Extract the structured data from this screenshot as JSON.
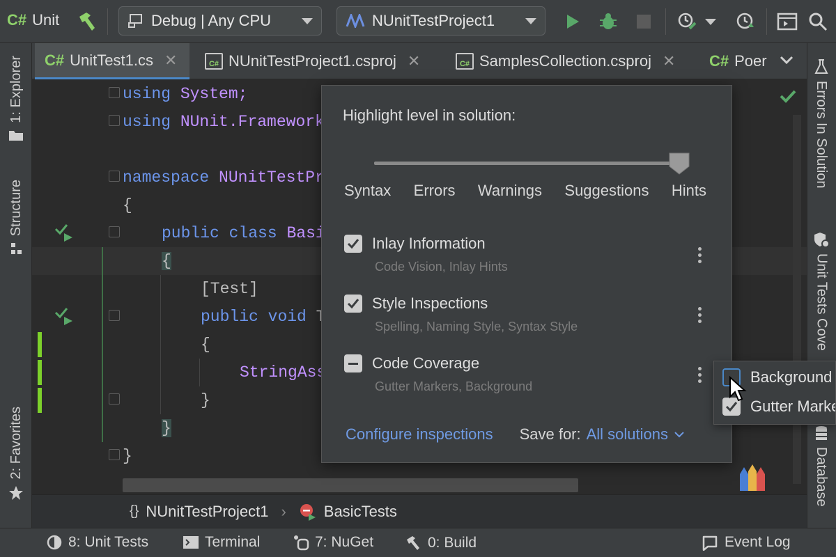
{
  "toolbar": {
    "lang_tag": "C#",
    "project": "Unit",
    "config": "Debug | Any CPU",
    "run_config": "NUnitTestProject1",
    "icons": [
      "hammer-icon",
      "run-icon",
      "debug-icon",
      "stop-icon",
      "profile-icon",
      "coverage-icon",
      "layout-icon",
      "search-icon"
    ]
  },
  "tabs": [
    {
      "tag": "C#",
      "label": "UnitTest1.cs",
      "active": true
    },
    {
      "tag": "C#",
      "label": "NUnitTestProject1.csproj"
    },
    {
      "tag": "C#",
      "label": "SamplesCollection.csproj"
    },
    {
      "tag": "C#",
      "label": "Poer"
    }
  ],
  "left_tools": {
    "explorer": "1: Explorer",
    "structure": "Structure",
    "favorites": "2: Favorites"
  },
  "right_tools": {
    "errors": "Errors In Solution",
    "unit_tests_coverage": "Unit Tests Cove",
    "database": "Database"
  },
  "code": {
    "line1_kw": "using",
    "line1_ns": "System;",
    "line2_kw": "using",
    "line2_ns": "NUnit.Framework",
    "line3_kw": "namespace",
    "line3_ns": "NUnitTestPr",
    "line4": "{",
    "line5_kw1": "public",
    "line5_kw2": "class",
    "line5_ns": "Basi",
    "line6": "{",
    "line7": "[Test]",
    "line8_kw1": "public",
    "line8_kw2": "void",
    "line8_rest": "T",
    "line9": "{",
    "line10": "StringAss",
    "line11": "}",
    "line12": "}",
    "line13": "}"
  },
  "breadcrumb": {
    "namespace": "NUnitTestProject1",
    "class": "BasicTests"
  },
  "bottom": {
    "unit_tests": "8: Unit Tests",
    "terminal": "Terminal",
    "nuget": "7: NuGet",
    "build": "0: Build",
    "event_log": "Event Log"
  },
  "popup": {
    "title": "Highlight level in solution:",
    "levels": [
      "Syntax",
      "Errors",
      "Warnings",
      "Suggestions",
      "Hints"
    ],
    "selected_level": "Hints",
    "options": [
      {
        "label": "Inlay Information",
        "sub": "Code Vision, Inlay Hints",
        "state": "checked"
      },
      {
        "label": "Style Inspections",
        "sub": "Spelling, Naming Style, Syntax Style",
        "state": "checked"
      },
      {
        "label": "Code Coverage",
        "sub": "Gutter Markers, Background",
        "state": "indeterminate"
      }
    ],
    "configure_link": "Configure inspections",
    "save_for_label": "Save for:",
    "save_for_value": "All solutions"
  },
  "submenu": {
    "items": [
      {
        "label": "Background",
        "checked": false
      },
      {
        "label": "Gutter Markers",
        "checked": true
      }
    ]
  },
  "colors": {
    "accent_green": "#8fd16b",
    "link_blue": "#6f9ae3",
    "keyword": "#6c95eb",
    "identifier": "#c191ff"
  }
}
